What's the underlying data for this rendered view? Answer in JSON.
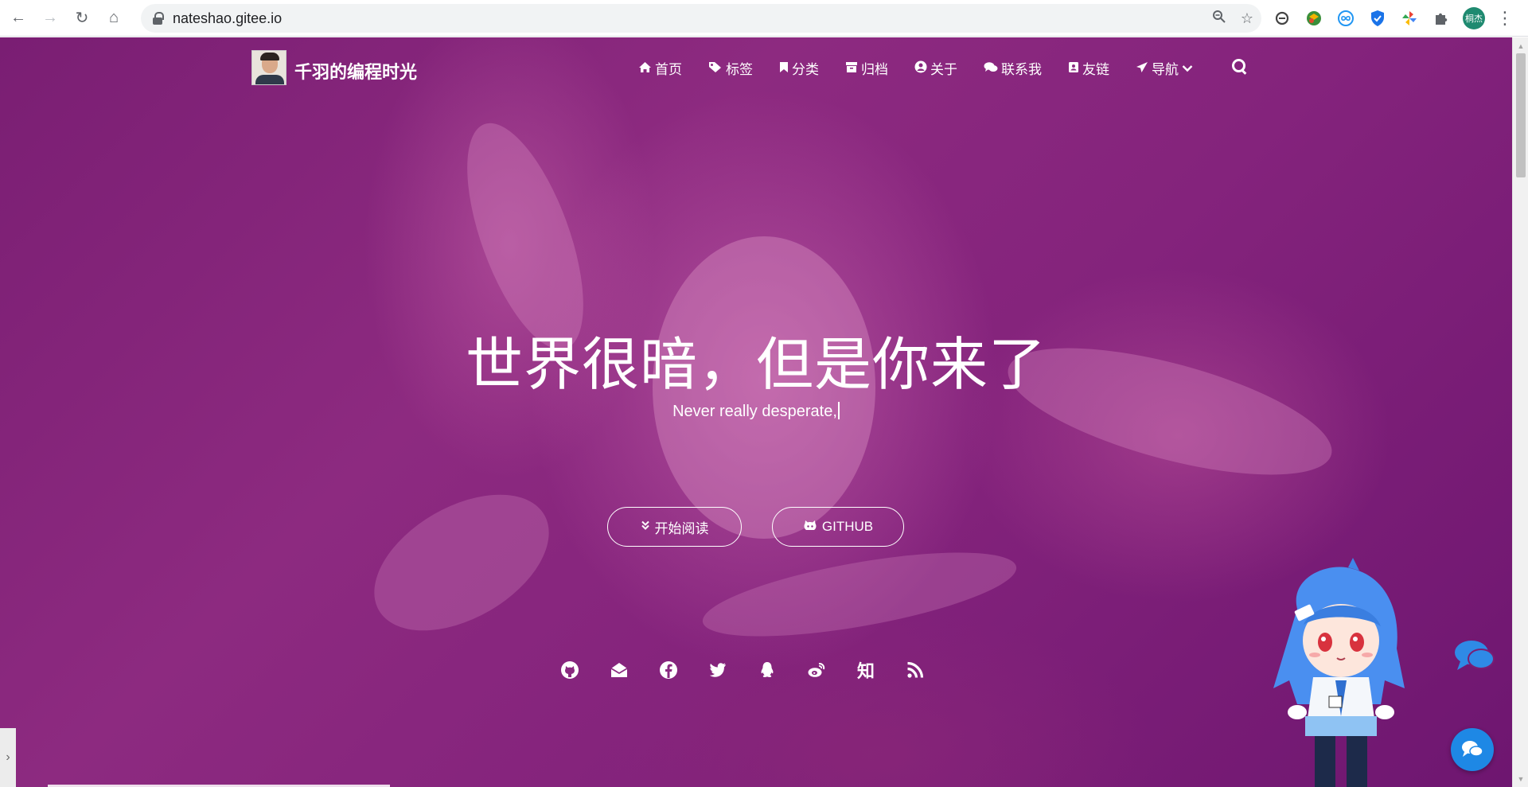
{
  "browser": {
    "url": "nateshao.gitee.io",
    "profile_label": "桐杰",
    "extensions": [
      "sync-icon",
      "map-extension-icon",
      "infinity-extension-icon",
      "shield-extension-icon",
      "pinwheel-extension-icon",
      "puzzle-extensions-icon"
    ]
  },
  "site": {
    "title": "千羽的编程时光",
    "menu": [
      {
        "label": "首页",
        "icon": "home-icon"
      },
      {
        "label": "标签",
        "icon": "tags-icon"
      },
      {
        "label": "分类",
        "icon": "bookmark-icon"
      },
      {
        "label": "归档",
        "icon": "archive-icon"
      },
      {
        "label": "关于",
        "icon": "user-circle-icon"
      },
      {
        "label": "联系我",
        "icon": "comments-icon"
      },
      {
        "label": "友链",
        "icon": "address-book-icon"
      },
      {
        "label": "导航",
        "icon": "paper-plane-icon"
      }
    ]
  },
  "hero": {
    "title": "世界很暗，但是你来了",
    "subtitle": "Never really desperate,",
    "read_button": "开始阅读",
    "github_button": "GITHUB",
    "social": [
      "github-icon",
      "envelope-icon",
      "facebook-icon",
      "twitter-icon",
      "qq-icon",
      "weibo-icon",
      "zhihu-icon",
      "rss-icon"
    ],
    "zhihu_label": "知"
  },
  "colors": {
    "hero_overlay": "#7a1e73",
    "chat_button": "#1e88e5",
    "profile": "#1f8a70"
  }
}
